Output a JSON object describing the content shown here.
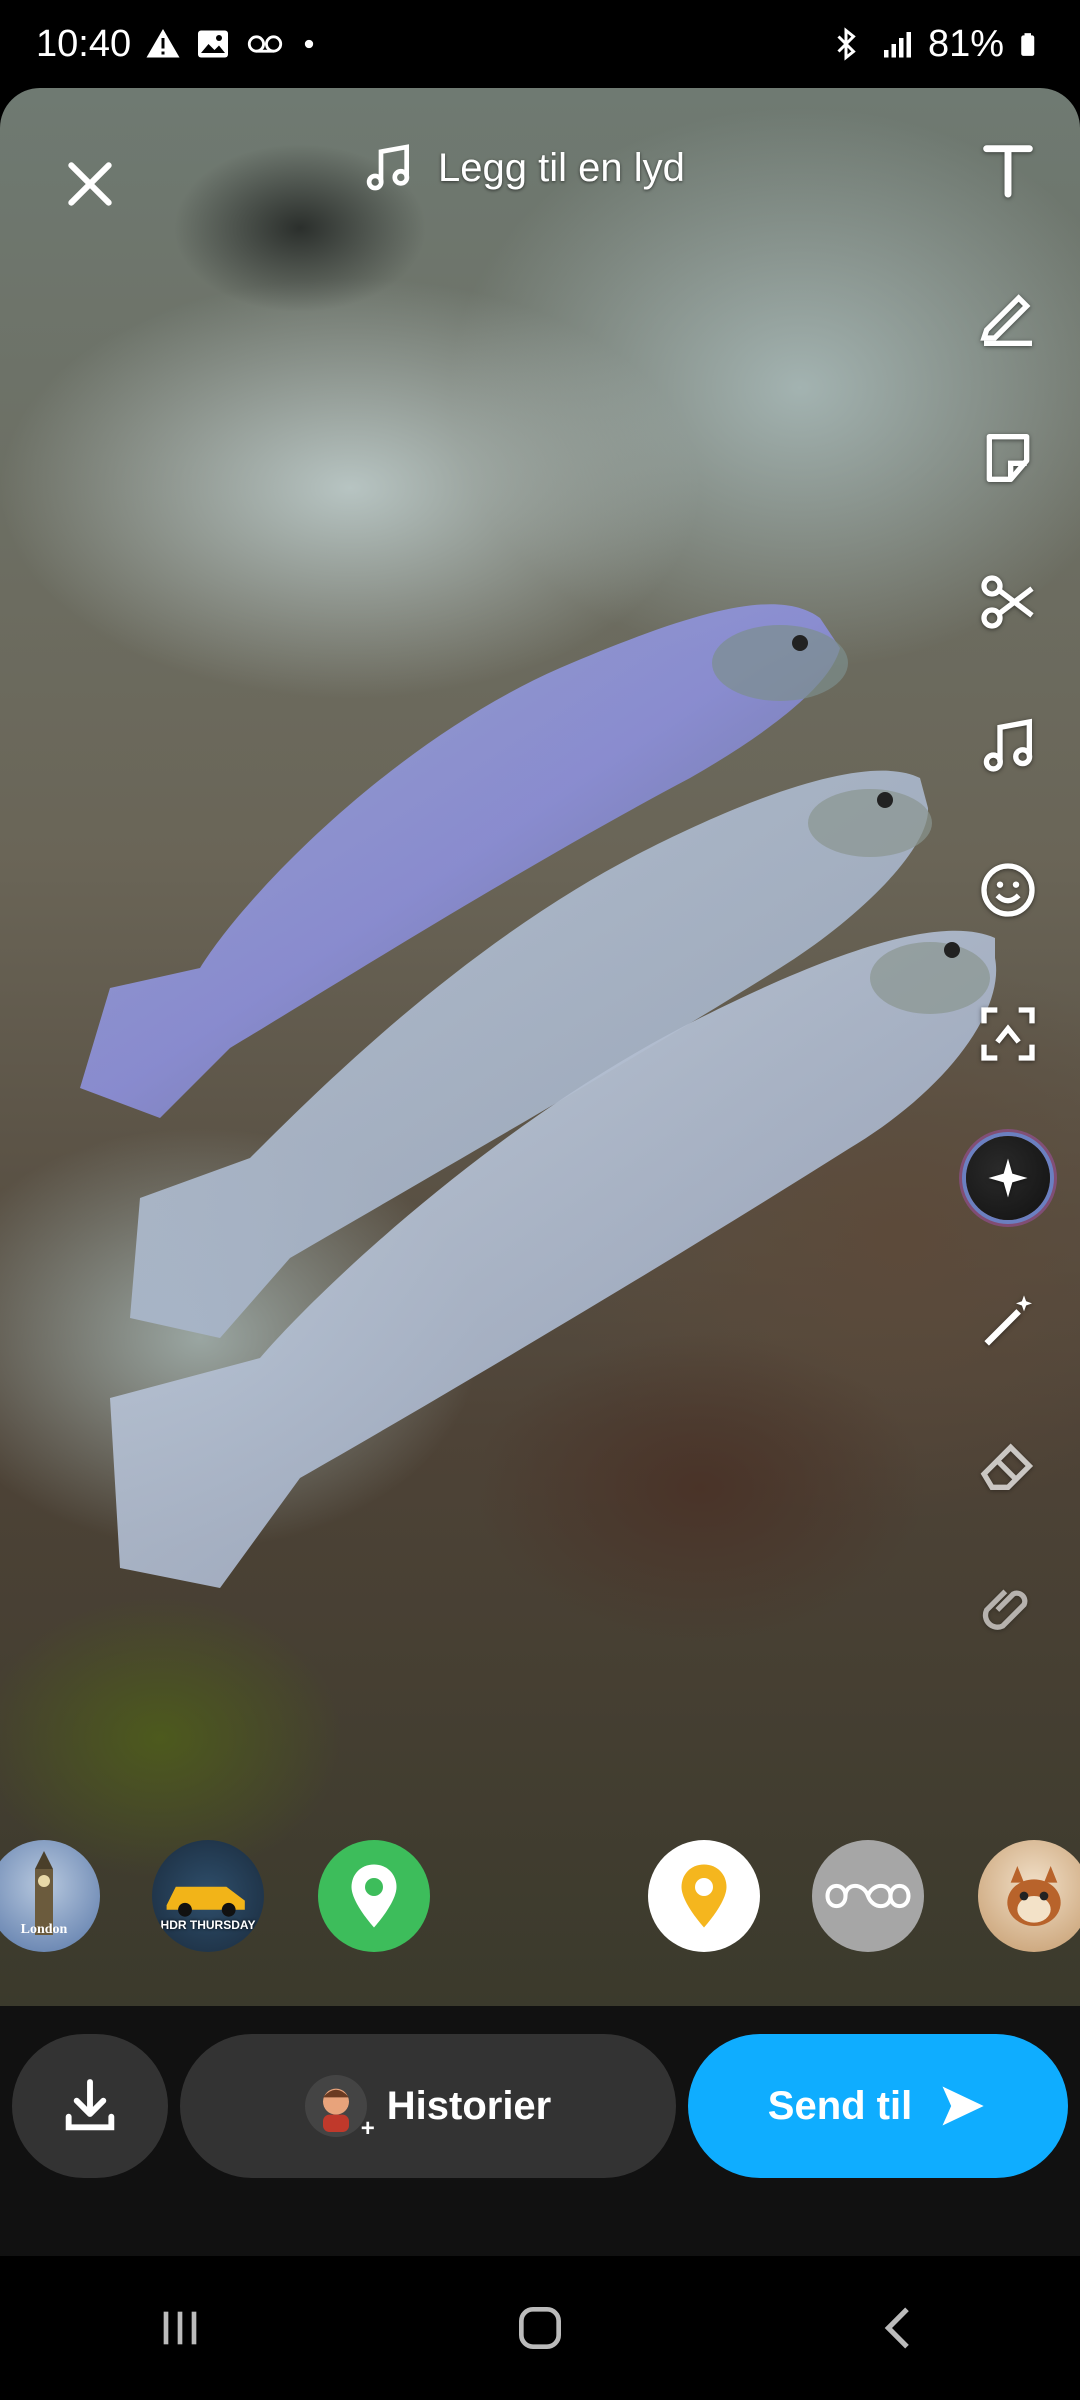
{
  "status_bar": {
    "time": "10:40",
    "battery": "81%",
    "left_icons": [
      "warning-icon",
      "image-icon",
      "voicemail-icon",
      "dot-icon"
    ],
    "right_icons": [
      "bluetooth-icon",
      "signal-icon",
      "battery-icon"
    ]
  },
  "editor": {
    "sound_label": "Legg til en lyd",
    "tools": [
      "text-tool-icon",
      "pencil-icon",
      "sticker-icon",
      "scissors-icon",
      "music-icon",
      "lens-icon",
      "crop-icon",
      "ai-sparkle-icon",
      "magic-wand-icon",
      "eraser-icon",
      "paperclip-icon"
    ],
    "filters": [
      {
        "name": "london-filter",
        "label": "London"
      },
      {
        "name": "hdr-thursday-filter",
        "label": "HDR THURSDAY"
      },
      {
        "name": "green-location-filter",
        "label": ""
      },
      {
        "name": "yellow-location-filter",
        "label": ""
      },
      {
        "name": "infinity-filter",
        "label": ""
      },
      {
        "name": "squirrel-filter",
        "label": ""
      }
    ]
  },
  "actions": {
    "stories_label": "Historier",
    "send_label": "Send til"
  },
  "colors": {
    "send_blue": "#0fadff",
    "button_gray": "#333333",
    "bar_bg": "#111111"
  }
}
